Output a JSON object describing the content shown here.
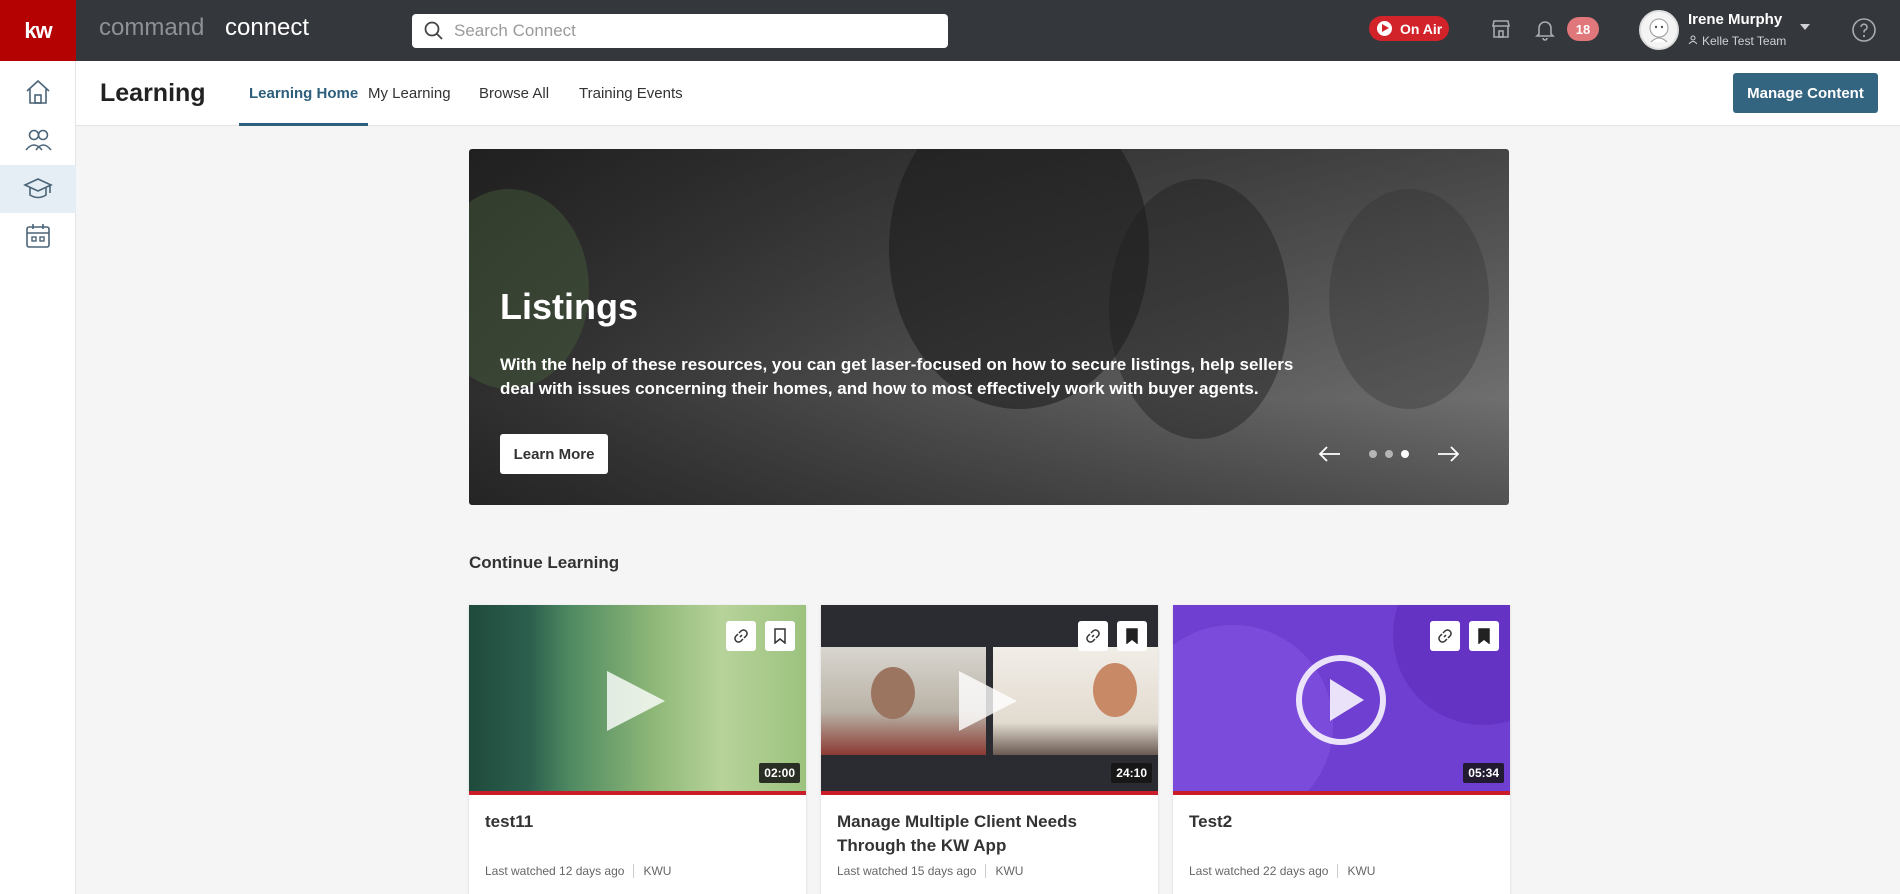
{
  "topbar": {
    "logo": "kw",
    "brand_command": "command",
    "brand_connect": "connect",
    "search_placeholder": "Search Connect",
    "on_air_label": "On Air",
    "notifications_count": "18",
    "user_name": "Irene Murphy",
    "user_team": "Kelle Test Team"
  },
  "subheader": {
    "title": "Learning",
    "tabs": [
      {
        "label": "Learning Home",
        "active": true
      },
      {
        "label": "My Learning"
      },
      {
        "label": "Browse All"
      },
      {
        "label": "Training Events"
      }
    ],
    "manage_content": "Manage Content"
  },
  "hero": {
    "title": "Listings",
    "description": "With the help of these resources, you can get laser-focused on how to secure listings, help sellers deal with issues concerning their homes, and how to most effectively work with buyer agents.",
    "cta": "Learn More",
    "slides": 3,
    "active_slide": 3
  },
  "continue_learning": {
    "title": "Continue Learning",
    "cards": [
      {
        "title": "test11",
        "duration": "02:00",
        "last_watched": "Last watched 12 days ago",
        "source": "KWU",
        "bookmarked": false
      },
      {
        "title": "Manage Multiple Client Needs Through the KW App",
        "duration": "24:10",
        "last_watched": "Last watched 15 days ago",
        "source": "KWU",
        "bookmarked": true
      },
      {
        "title": "Test2",
        "duration": "05:34",
        "last_watched": "Last watched 22 days ago",
        "source": "KWU",
        "bookmarked": true
      }
    ]
  },
  "colors": {
    "topbar": "#34373c",
    "logo": "#b40101",
    "accent": "#346580",
    "on_air": "#d3232a",
    "progress": "#c91e2a"
  }
}
